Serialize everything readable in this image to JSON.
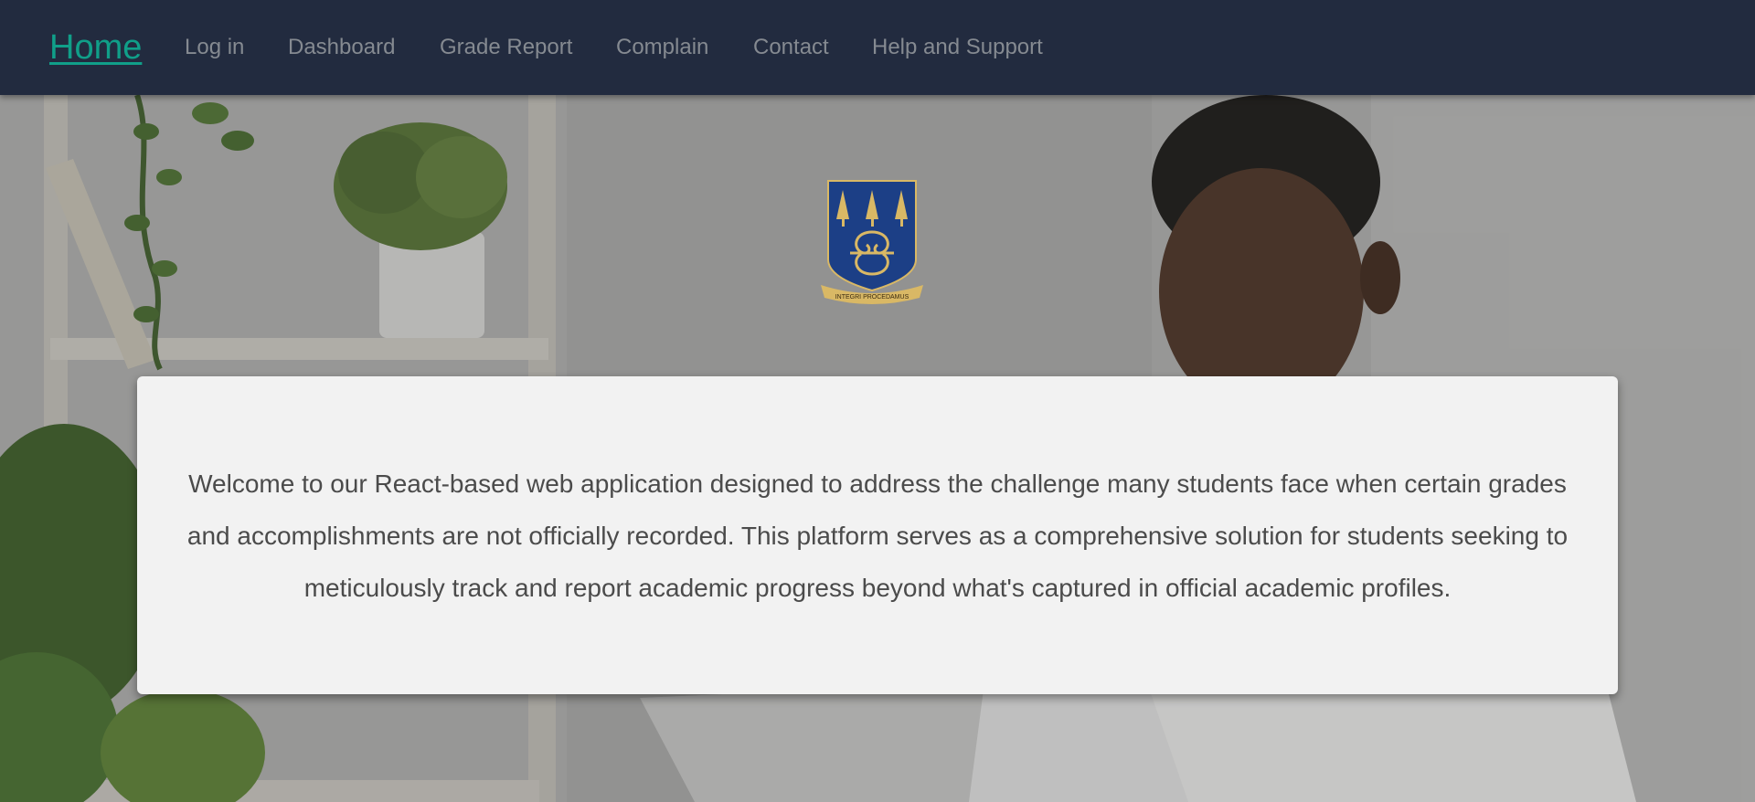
{
  "nav": {
    "home": "Home",
    "links": [
      "Log in",
      "Dashboard",
      "Grade Report",
      "Complain",
      "Contact",
      "Help and Support"
    ]
  },
  "crest": {
    "motto": "INTEGRI PROCEDAMUS"
  },
  "welcome": {
    "text": "Welcome to our React-based web application designed to address the challenge many students face when certain grades and accomplishments are not officially recorded. This platform serves as a comprehensive solution for students seeking to meticulously track and report academic progress beyond what's captured in official academic profiles."
  },
  "colors": {
    "navbar_bg": "#222b3f",
    "home_link": "#109f89",
    "nav_link": "#858a91",
    "card_bg": "#f2f2f2",
    "crest_blue": "#1c3f86",
    "crest_gold": "#d9b865"
  },
  "icons": [
    "university-crest-icon"
  ]
}
